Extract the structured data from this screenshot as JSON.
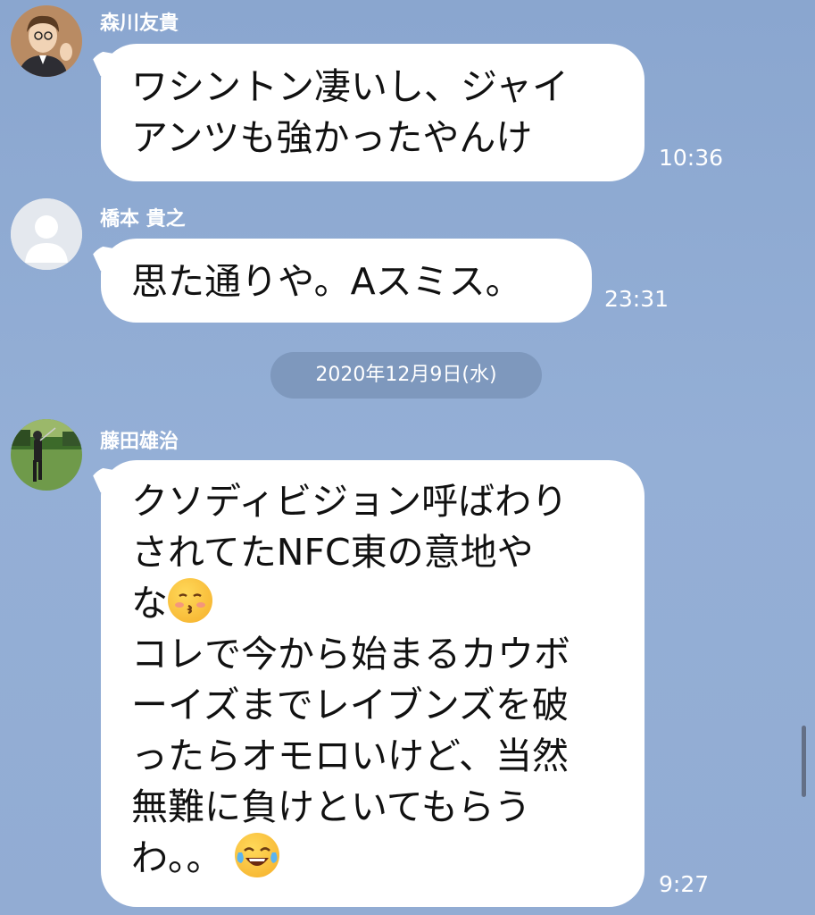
{
  "messages": [
    {
      "sender": "森川友貴",
      "text": "ワシントン凄いし、ジャイ\nアンツも強かったやんけ",
      "time": "10:36",
      "avatar": "avatar-illustration-icon"
    },
    {
      "sender": "橋本 貴之",
      "text": "思た通りや。Aスミス。",
      "time": "23:31",
      "avatar": "default-user-icon"
    },
    {
      "sender": "藤田雄治",
      "text_lines": [
        "クソディビジョン呼ばわり",
        "されてたNFC東の意地や",
        "な",
        "コレで今から始まるカウボ",
        "ーイズまでレイブンズを破",
        "ったらオモロいけど、当然",
        "無難に負けといてもらう",
        "わ。。"
      ],
      "time": "9:27",
      "avatar": "golf-photo-icon"
    }
  ],
  "date_separator": "2020年12月9日(水)",
  "emojis": [
    "kissing-face-icon",
    "tears-of-joy-icon"
  ]
}
